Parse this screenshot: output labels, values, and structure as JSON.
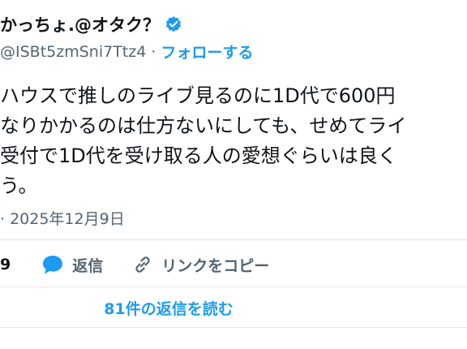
{
  "author": {
    "display_name": "かっちょ.@オタク？",
    "handle": "@ISBt5zmSni7Ttz4",
    "separator": "·",
    "follow_label": "フォローする"
  },
  "tweet": {
    "lines": [
      "ハウスで推しのライブ見るのに1D代で600円",
      "なりかかるのは仕方ないにしても、せめてライ",
      "受付で1D代を受け取る人の愛想ぐらいは良く",
      "う。"
    ],
    "meta": "· 2025年12月9日"
  },
  "actions": {
    "like_count": "9",
    "reply_label": "返信",
    "copy_link_label": "リンクをコピー"
  },
  "replies": {
    "read_label": "81件の返信を読む"
  },
  "colors": {
    "accent": "#1d9bf0",
    "muted": "#536471",
    "text": "#0f1419"
  }
}
